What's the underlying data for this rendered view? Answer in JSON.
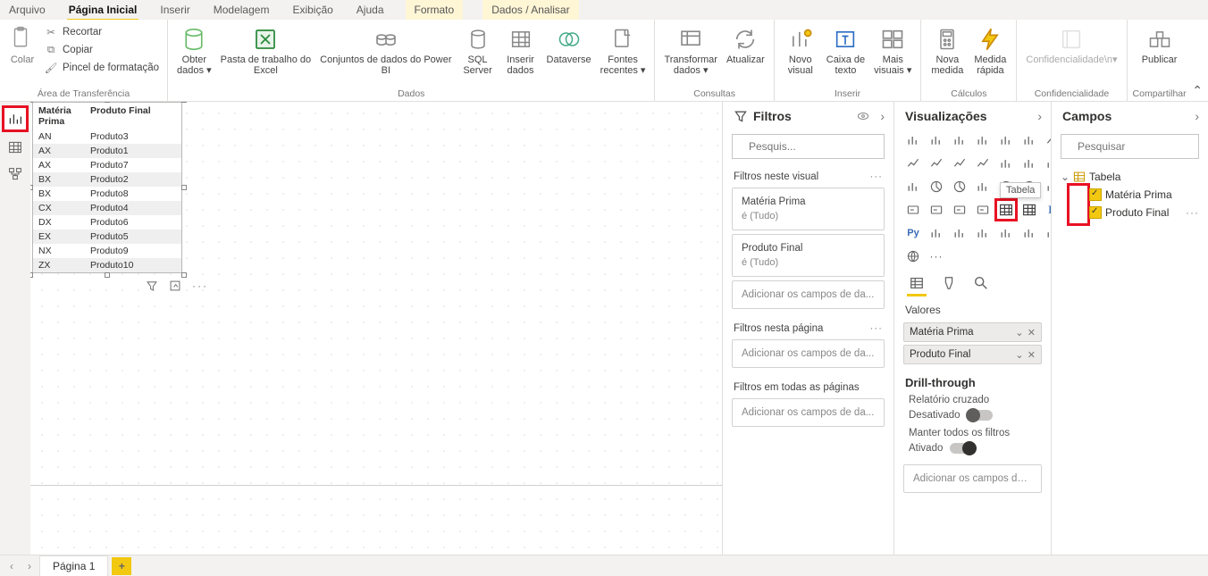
{
  "menu": {
    "items": [
      "Arquivo",
      "Página Inicial",
      "Inserir",
      "Modelagem",
      "Exibição",
      "Ajuda",
      "Formato",
      "Dados / Analisar"
    ],
    "active": "Página Inicial",
    "yellow": [
      "Formato",
      "Dados / Analisar"
    ]
  },
  "ribbon": {
    "paste": "Colar",
    "clipboard": {
      "cut": "Recortar",
      "copy": "Copiar",
      "format": "Pincel de formatação",
      "group": "Área de Transferência"
    },
    "data": {
      "obter": "Obter\ndados",
      "excel": "Pasta de trabalho do\nExcel",
      "pbi": "Conjuntos de dados do Power\nBI",
      "sql": "SQL\nServer",
      "inserir": "Inserir\ndados",
      "dataverse": "Dataverse",
      "fontes": "Fontes\nrecentes",
      "group": "Dados"
    },
    "queries": {
      "transform": "Transformar\ndados",
      "refresh": "Atualizar",
      "group": "Consultas"
    },
    "insert": {
      "novo": "Novo\nvisual",
      "caixa": "Caixa de\ntexto",
      "mais": "Mais\nvisuais",
      "group": "Inserir"
    },
    "calc": {
      "medida": "Nova\nmedida",
      "rapida": "Medida\nrápida",
      "group": "Cálculos"
    },
    "conf": {
      "label": "Confidencialidade",
      "group": "Confidencialidade"
    },
    "share": {
      "publicar": "Publicar",
      "group": "Compartilhar"
    }
  },
  "visual_table": {
    "headers": [
      "Matéria Prima",
      "Produto Final"
    ],
    "rows": [
      [
        "AN",
        "Produto3"
      ],
      [
        "AX",
        "Produto1"
      ],
      [
        "AX",
        "Produto7"
      ],
      [
        "BX",
        "Produto2"
      ],
      [
        "BX",
        "Produto8"
      ],
      [
        "CX",
        "Produto4"
      ],
      [
        "DX",
        "Produto6"
      ],
      [
        "EX",
        "Produto5"
      ],
      [
        "NX",
        "Produto9"
      ],
      [
        "ZX",
        "Produto10"
      ]
    ]
  },
  "filters": {
    "title": "Filtros",
    "search": "Pesquis...",
    "sections": {
      "visual": "Filtros neste visual",
      "page": "Filtros nesta página",
      "all": "Filtros em todas as páginas"
    },
    "cards": {
      "mp": {
        "title": "Matéria Prima",
        "sub": "é (Tudo)"
      },
      "pf": {
        "title": "Produto Final",
        "sub": "é (Tudo)"
      },
      "add": "Adicionar os campos de da..."
    }
  },
  "viz": {
    "title": "Visualizações",
    "tooltip": "Tabela",
    "valores": "Valores",
    "pills": [
      "Matéria Prima",
      "Produto Final"
    ],
    "drill": "Drill-through",
    "cross": "Relatório cruzado",
    "off": "Desativado",
    "keep": "Manter todos os filtros",
    "on": "Ativado",
    "add": "Adicionar os campos de dr..."
  },
  "fields": {
    "title": "Campos",
    "search": "Pesquisar",
    "table": "Tabela",
    "items": [
      "Matéria Prima",
      "Produto Final"
    ]
  },
  "page_tab": "Página 1"
}
